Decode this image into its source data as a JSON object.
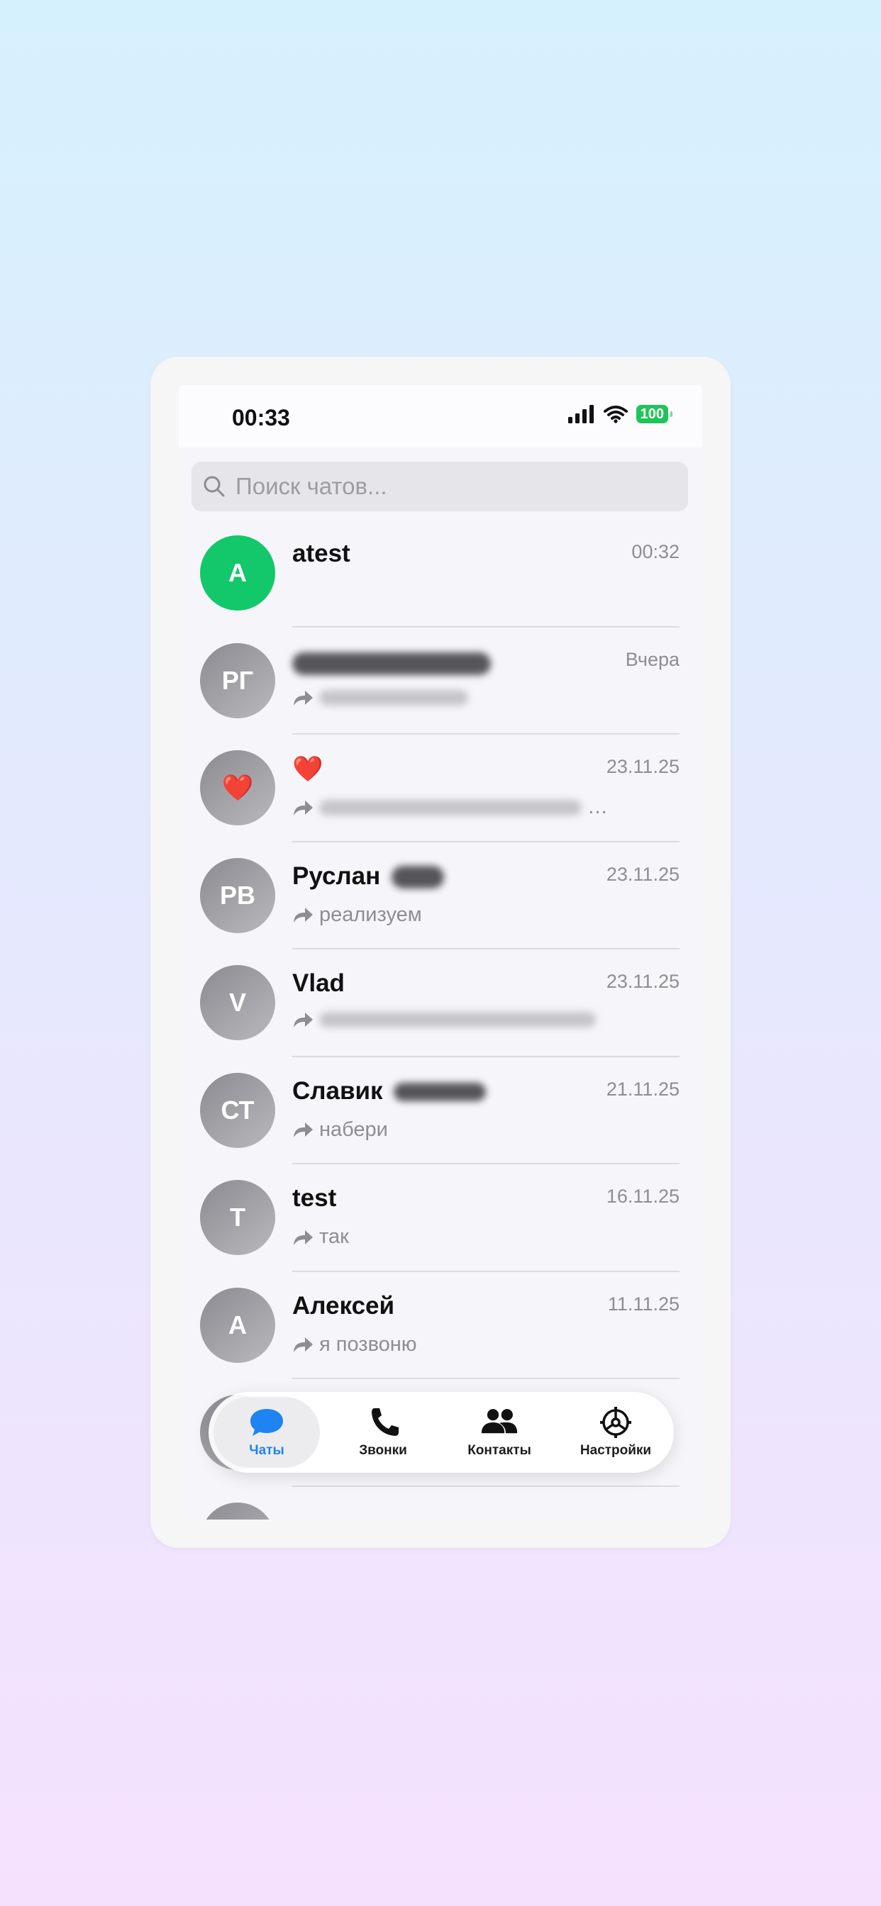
{
  "status": {
    "time": "00:33",
    "battery": "100"
  },
  "search": {
    "placeholder": "Поиск чатов..."
  },
  "chats": [
    {
      "initials": "A",
      "name": "atest",
      "date": "00:32",
      "preview": ""
    },
    {
      "initials": "РГ",
      "name": "",
      "date": "Вчера",
      "preview": ""
    },
    {
      "initials": "❤️",
      "name": "❤️",
      "date": "23.11.25",
      "preview": "…"
    },
    {
      "initials": "РВ",
      "name": "Руслан",
      "date": "23.11.25",
      "preview": "реализуем"
    },
    {
      "initials": "V",
      "name": "Vlad",
      "date": "23.11.25",
      "preview": ""
    },
    {
      "initials": "СТ",
      "name": "Славик",
      "date": "21.11.25",
      "preview": "набери"
    },
    {
      "initials": "T",
      "name": "test",
      "date": "16.11.25",
      "preview": "так"
    },
    {
      "initials": "А",
      "name": "Алексей",
      "date": "11.11.25",
      "preview": "я позвоню"
    }
  ],
  "tabs": [
    {
      "label": "Чаты"
    },
    {
      "label": "Звонки"
    },
    {
      "label": "Контакты"
    },
    {
      "label": "Настройки"
    }
  ],
  "colors": {
    "accent": "#1e84f2",
    "online_avatar": "#12c86a",
    "battery": "#20c45a"
  }
}
